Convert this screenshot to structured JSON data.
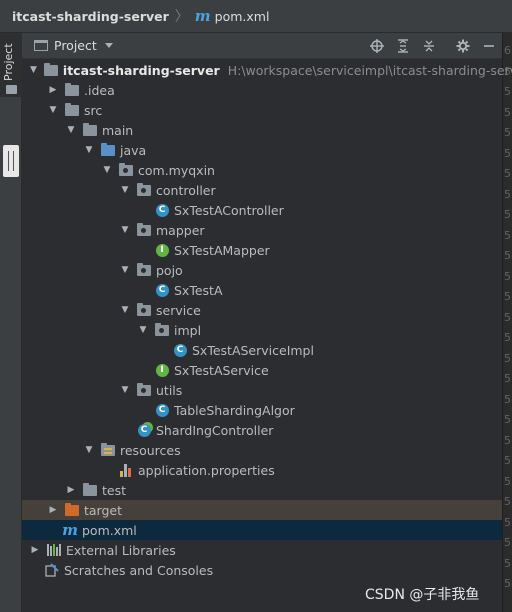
{
  "breadcrumb": {
    "project": "itcast-sharding-server",
    "separator": "〉",
    "file_icon": "m",
    "file": "pom.xml"
  },
  "left_strip": {
    "project_tab": "Project"
  },
  "panel": {
    "title": "Project"
  },
  "tree": {
    "root_name": "itcast-sharding-server",
    "root_path": "H:\\workspace\\serviceimpl\\itcast-sharding-server",
    "idea": ".idea",
    "src": "src",
    "main": "main",
    "java": "java",
    "package": "com.myqxin",
    "controller": "controller",
    "controller_class": "SxTestAController",
    "controller_class_icon": "C",
    "mapper": "mapper",
    "mapper_iface": "SxTestAMapper",
    "mapper_iface_icon": "I",
    "pojo": "pojo",
    "pojo_class": "SxTestA",
    "pojo_class_icon": "C",
    "service": "service",
    "impl": "impl",
    "impl_class": "SxTestAServiceImpl",
    "impl_class_icon": "C",
    "service_iface": "SxTestAService",
    "service_iface_icon": "I",
    "utils": "utils",
    "utils_class": "TableShardingAlgor",
    "utils_class_icon": "C",
    "sharding_class": "ShardIngController",
    "sharding_class_icon": "C",
    "resources": "resources",
    "properties_file": "application.properties",
    "test": "test",
    "target": "target",
    "pom_icon": "m",
    "pom": "pom.xml",
    "external_libs": "External Libraries",
    "scratches": "Scratches and Consoles"
  },
  "right_gutter": [
    "6",
    "5",
    "5",
    "5",
    "5",
    "5",
    "5",
    "5",
    "5",
    "5",
    "5",
    "5",
    "5",
    "5",
    "5",
    "5",
    "5",
    "5",
    "5",
    "5",
    "5",
    "5",
    "5",
    "5",
    "5",
    "5",
    "5"
  ],
  "watermark": "CSDN @子非我鱼",
  "colors": {
    "accent": "#3592c4",
    "interface": "#62b543",
    "excluded_folder": "#d0692a",
    "selected_row": "#0d293e"
  }
}
